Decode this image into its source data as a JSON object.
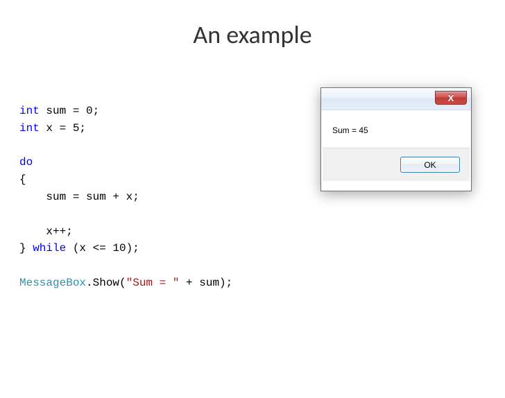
{
  "title": "An example",
  "code": {
    "line1_kw": "int",
    "line1_rest": " sum = 0;",
    "line2_kw": "int",
    "line2_rest": " x = 5;",
    "line4_kw": "do",
    "line5": "{",
    "line6": "    sum = sum + x;",
    "line8": "    x++;",
    "line9_a": "} ",
    "line9_kw": "while",
    "line9_b": " (x <= 10);",
    "line11_cls": "MessageBox",
    "line11_a": ".Show(",
    "line11_str": "\"Sum = \"",
    "line11_b": " + sum);"
  },
  "dialog": {
    "close_glyph": "X",
    "message": "Sum = 45",
    "ok_label": "OK"
  }
}
